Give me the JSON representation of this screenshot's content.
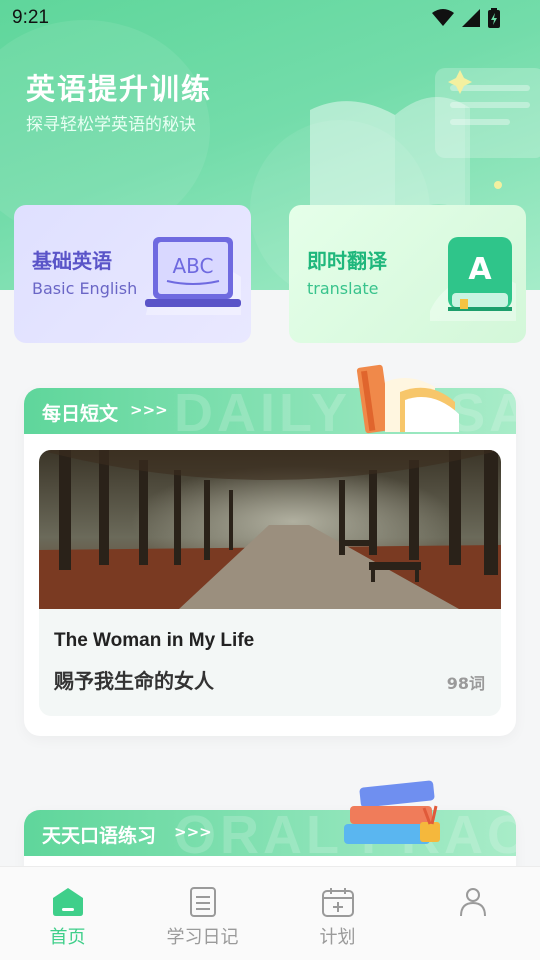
{
  "status": {
    "time": "9:21"
  },
  "header": {
    "title": "英语提升训练",
    "subtitle": "探寻轻松学英语的秘诀"
  },
  "cards": [
    {
      "title": "基础英语",
      "subtitle": "Basic English",
      "icon": "laptop-abc-icon",
      "icon_text": "ABC"
    },
    {
      "title": "即时翻译",
      "subtitle": "translate",
      "icon": "book-a-icon",
      "icon_text": "A"
    }
  ],
  "essay_section": {
    "title": "每日短文",
    "arrows": ">>>",
    "watermark": "DAILY ESSAY",
    "item": {
      "title_en": "The Woman in My Life",
      "title_cn": "赐予我生命的女人",
      "word_count": "98词"
    }
  },
  "oral_section": {
    "title": "天天口语练习",
    "arrows": ">>>",
    "watermark": "ORAL PRACTICE"
  },
  "nav": [
    {
      "label": "首页",
      "icon": "home-icon",
      "active": true
    },
    {
      "label": "学习日记",
      "icon": "diary-icon",
      "active": false
    },
    {
      "label": "计划",
      "icon": "calendar-icon",
      "active": false
    },
    {
      "label": "",
      "icon": "profile-icon",
      "active": false
    }
  ],
  "colors": {
    "accent": "#3fcf8a",
    "header_green": "#5fd69b",
    "basic_purple": "#5a54c8"
  }
}
